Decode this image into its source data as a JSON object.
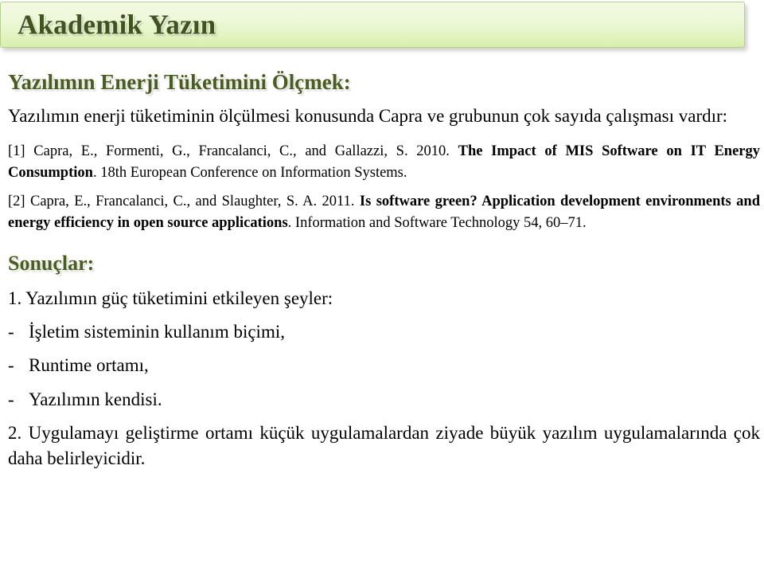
{
  "banner": {
    "title": "Akademik Yazın",
    "colors": {
      "text": "#41541f",
      "gradient_top": "#f2fae3",
      "gradient_bottom": "#d7eeab",
      "border": "#b6cf8e"
    }
  },
  "slide": {
    "subtitle": "Yazılımın Enerji Tüketimini Ölçmek:",
    "lead_paragraph": "Yazılımın enerji tüketiminin ölçülmesi konusunda Capra ve grubunun çok sayıda çalışması vardır:",
    "references": [
      {
        "marker": "[1]",
        "authors": "Capra, E., Formenti, G., Francalanci, C., and Gallazzi, S. 2010.",
        "title": "The Impact of MIS Software on IT Energy Consumption",
        "source": "18th European Conference on Information Systems."
      },
      {
        "marker": "[2]",
        "authors": "Capra, E., Francalanci, C., and Slaughter, S. A. 2011.",
        "title": "Is software green? Application development environments and energy efficiency in open source applications",
        "source": "Information and Software Technology 54, 60–71."
      }
    ],
    "results_heading": "Sonuçlar:",
    "results": [
      {
        "number": "1.",
        "text": "Yazılımın güç tüketimini etkileyen şeyler:",
        "sub_items": [
          {
            "marker": "-",
            "text": "İşletim sisteminin kullanım biçimi,"
          },
          {
            "marker": "-",
            "text": "Runtime ortamı,"
          },
          {
            "marker": "-",
            "text": "Yazılımın kendisi."
          }
        ]
      },
      {
        "number": "2.",
        "text": "Uygulamayı geliştirme ortamı küçük uygulamalardan ziyade büyük yazılım uygulamalarında çok daha belirleyicidir."
      }
    ]
  }
}
